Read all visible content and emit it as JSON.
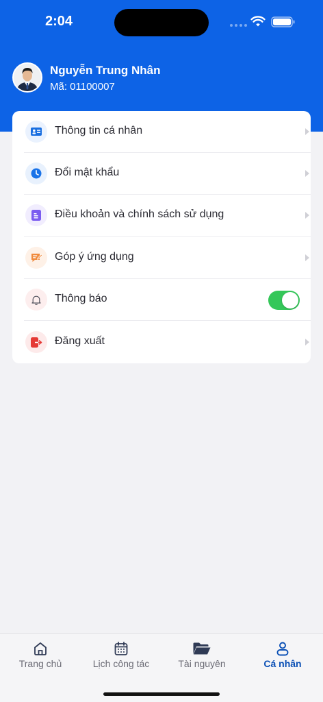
{
  "status_bar": {
    "time": "2:04"
  },
  "profile": {
    "name": "Nguyễn Trung Nhân",
    "code": "Mã: 01100007"
  },
  "menu": {
    "items": [
      {
        "label": "Thông tin cá nhân",
        "icon": "id-card-icon",
        "color": "#1a6fe0"
      },
      {
        "label": "Đổi mật khẩu",
        "icon": "clock-icon",
        "color": "#1a73e8"
      },
      {
        "label": "Điều khoản và chính sách sử dụng",
        "icon": "document-icon",
        "color": "#7b5cf0"
      },
      {
        "label": "Góp ý ứng dụng",
        "icon": "feedback-icon",
        "color": "#f08a3c"
      },
      {
        "label": "Thông báo",
        "icon": "bell-icon",
        "color": "#555560",
        "toggle_on": true
      },
      {
        "label": "Đăng xuất",
        "icon": "logout-icon",
        "color": "#e53935"
      }
    ]
  },
  "tabs": [
    {
      "label": "Trang chủ",
      "icon": "home-icon"
    },
    {
      "label": "Lịch công tác",
      "icon": "calendar-icon"
    },
    {
      "label": "Tài nguyên",
      "icon": "folder-icon"
    },
    {
      "label": "Cá nhân",
      "icon": "person-icon",
      "active": true
    }
  ],
  "colors": {
    "header": "#0d63e6",
    "toggle_on": "#34c759",
    "active_tab": "#0a4fb5"
  }
}
